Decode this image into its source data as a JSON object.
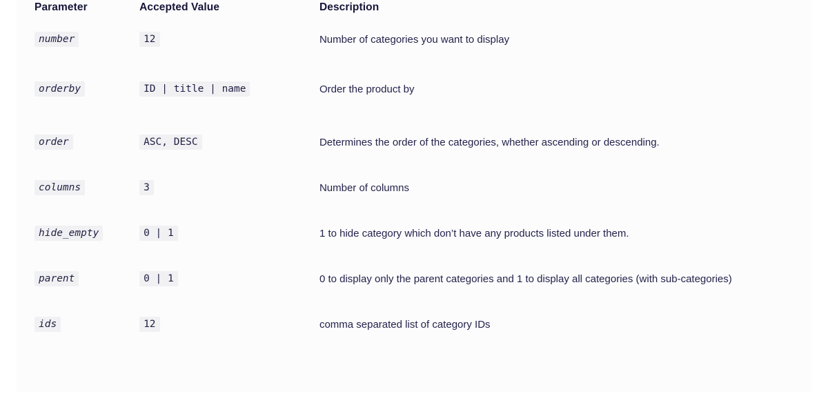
{
  "table": {
    "headers": {
      "parameter": "Parameter",
      "accepted_value": "Accepted Value",
      "description": "Description"
    },
    "rows": [
      {
        "parameter": "number",
        "accepted_value": "12",
        "description": "Number of categories you want to display"
      },
      {
        "parameter": "orderby",
        "accepted_value": "ID | title | name",
        "description": "Order the product by"
      },
      {
        "parameter": "order",
        "accepted_value": "ASC, DESC",
        "description": "Determines the order of the categories, whether ascending or descending."
      },
      {
        "parameter": "columns",
        "accepted_value": "3",
        "description": "Number of columns"
      },
      {
        "parameter": "hide_empty",
        "accepted_value": "0 | 1",
        "description": "1 to hide category which don’t have any products listed under them."
      },
      {
        "parameter": "parent",
        "accepted_value": "0 | 1",
        "description": "0 to display only the parent categories and 1 to display all categories (with sub-categories)"
      },
      {
        "parameter": "ids",
        "accepted_value": "12",
        "description": "comma separated list of category IDs"
      }
    ]
  },
  "colors": {
    "text": "#23234a",
    "heading": "#161638",
    "code_background": "#f1f1f3",
    "page_background": "#ffffff",
    "panel_background": "#fcfcfd"
  }
}
